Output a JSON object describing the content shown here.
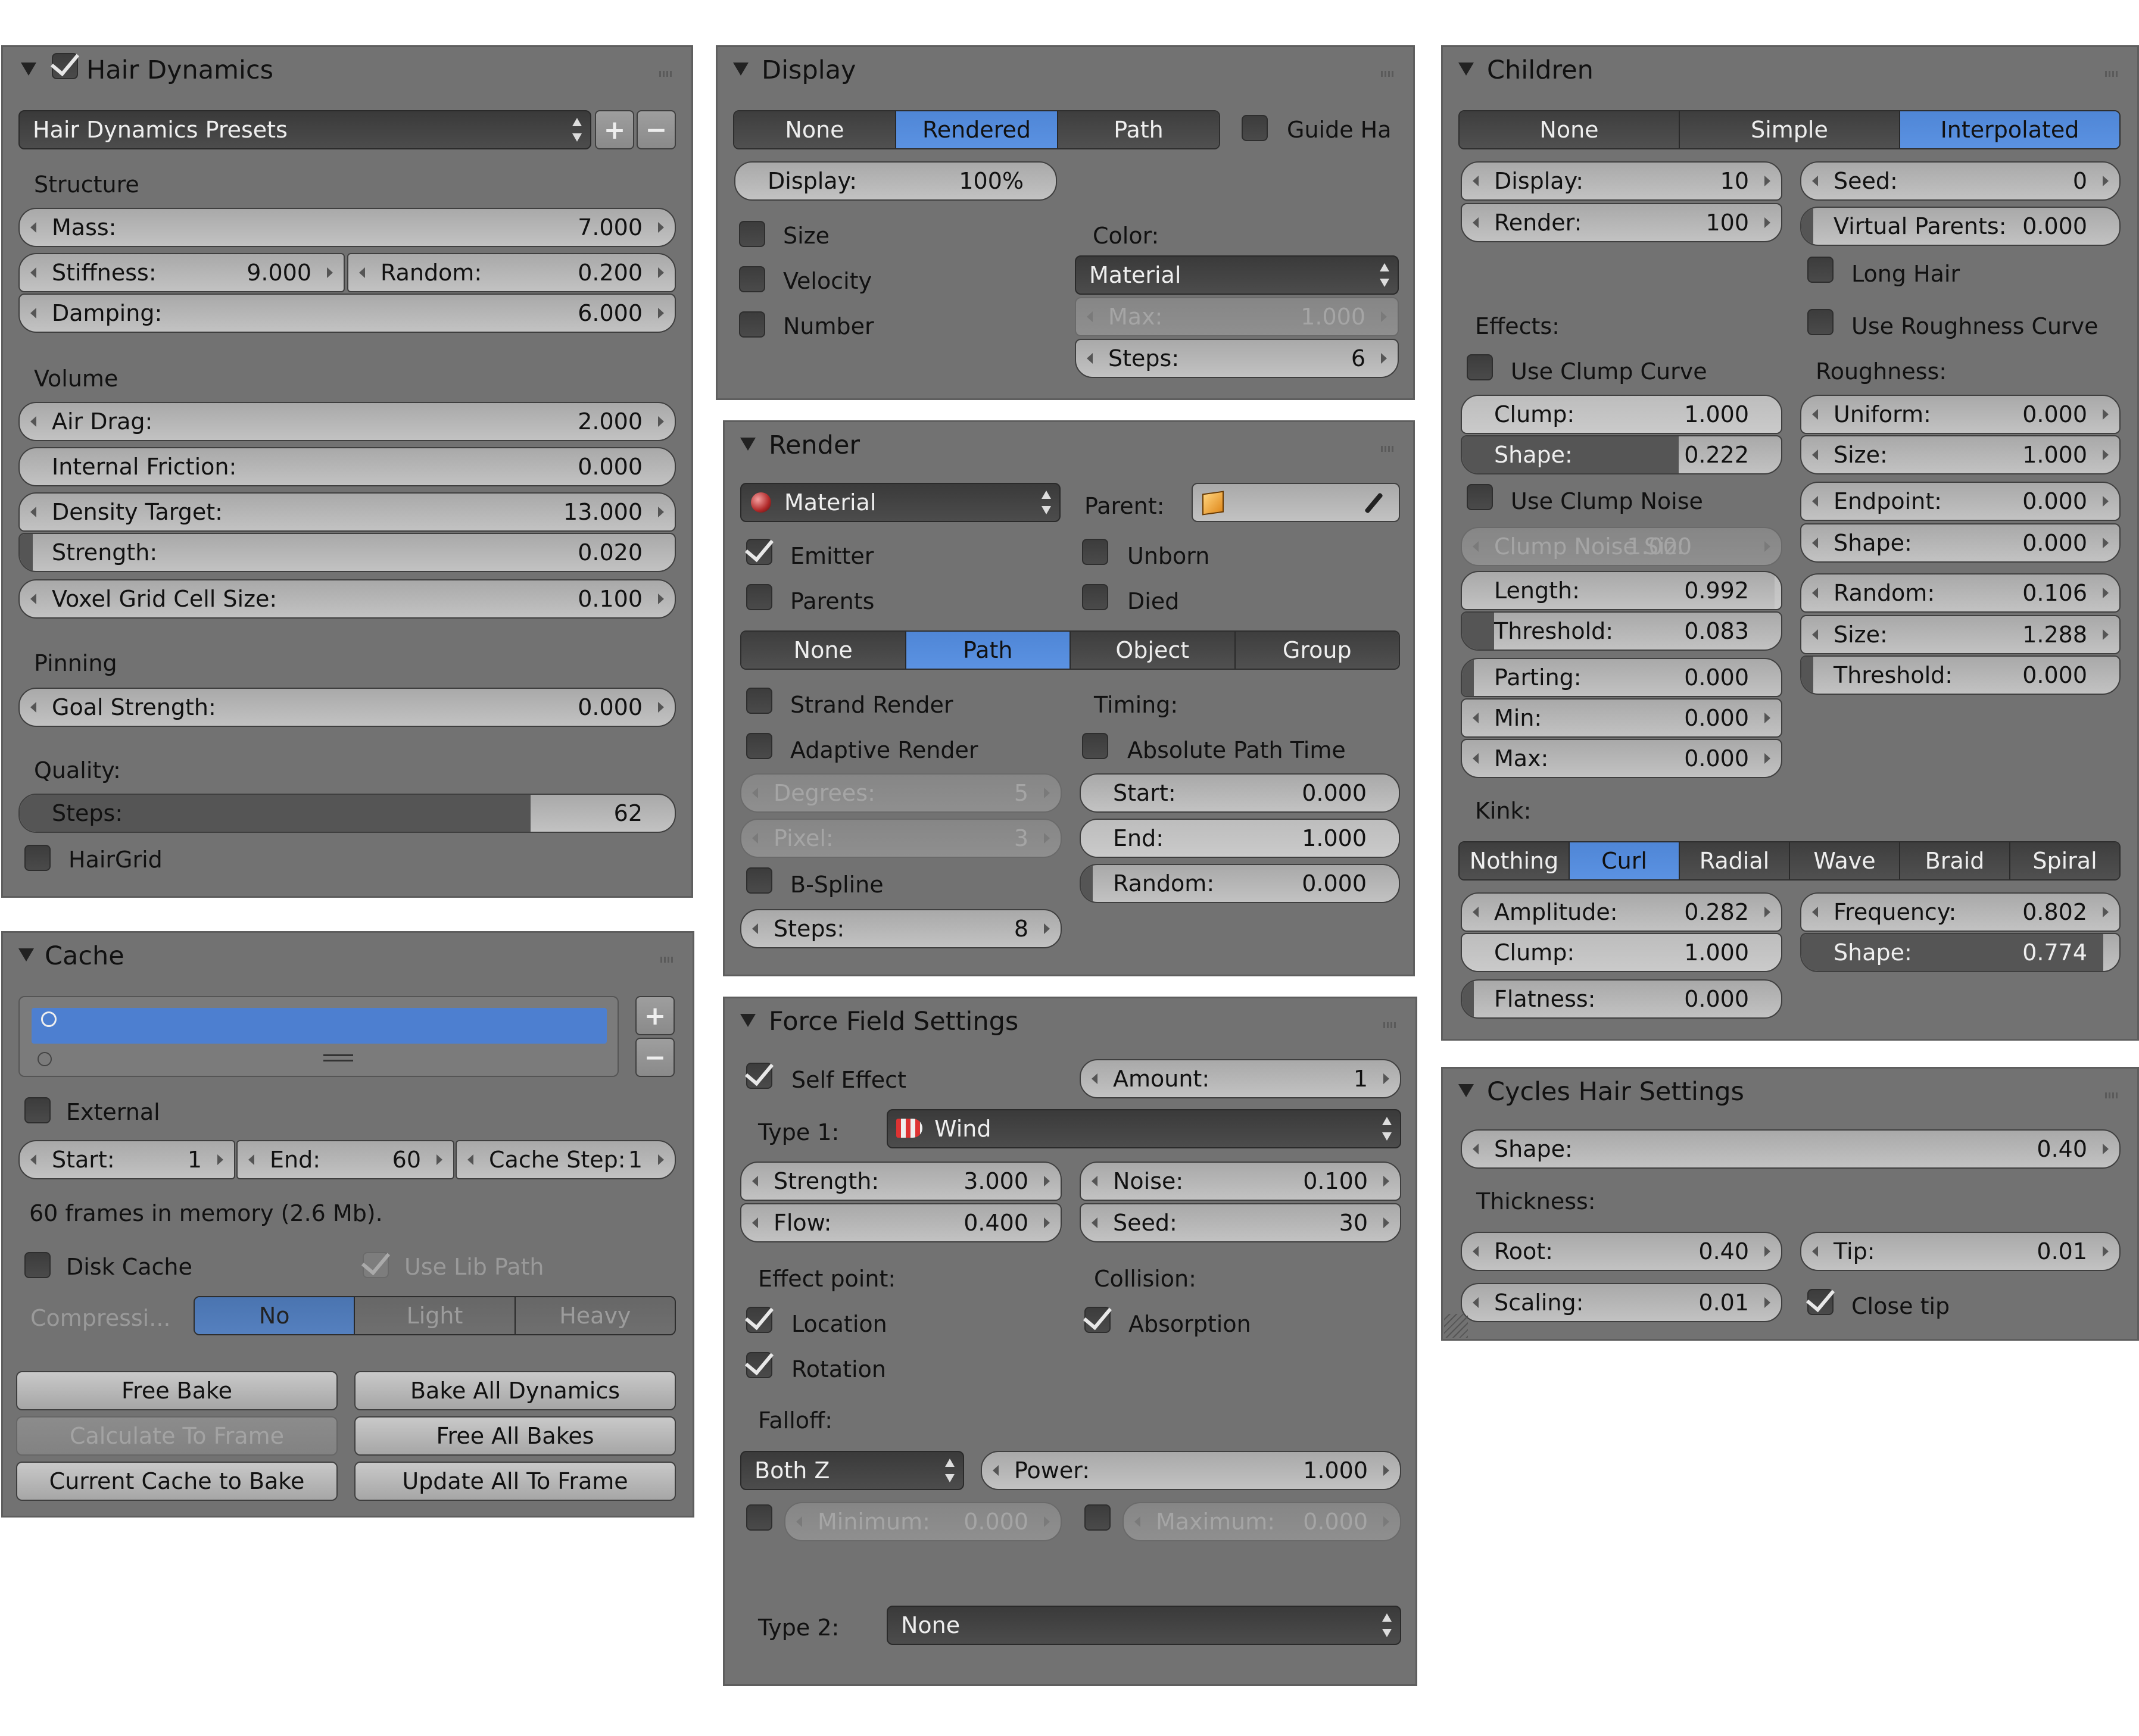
{
  "hair_dynamics": {
    "title": "Hair Dynamics",
    "presets": "Hair Dynamics Presets",
    "add": "+",
    "remove": "−",
    "structure": "Structure",
    "mass_l": "Mass:",
    "mass_v": "7.000",
    "stiff_l": "Stiffness:",
    "stiff_v": "9.000",
    "rand_l": "Random:",
    "rand_v": "0.200",
    "damp_l": "Damping:",
    "damp_v": "6.000",
    "volume": "Volume",
    "air_l": "Air Drag:",
    "air_v": "2.000",
    "fric_l": "Internal Friction:",
    "fric_v": "0.000",
    "dens_l": "Density Target:",
    "dens_v": "13.000",
    "str_l": "Strength:",
    "str_v": "0.020",
    "voxel_l": "Voxel Grid Cell Size:",
    "voxel_v": "0.100",
    "pinning": "Pinning",
    "goal_l": "Goal Strength:",
    "goal_v": "0.000",
    "quality": "Quality:",
    "steps_l": "Steps:",
    "steps_v": "62",
    "steps_fill": 0.78,
    "hairgrid": "HairGrid"
  },
  "cache": {
    "title": "Cache",
    "external": "External",
    "start_l": "Start:",
    "start_v": "1",
    "end_l": "End:",
    "end_v": "60",
    "step_l": "Cache Step:",
    "step_v": "1",
    "info": "60 frames in memory (2.6 Mb).",
    "disk": "Disk Cache",
    "lib": "Use Lib Path",
    "compress": "Compressi...",
    "comp_opts": [
      "No",
      "Light",
      "Heavy"
    ],
    "free_bake": "Free Bake",
    "bake_all": "Bake All Dynamics",
    "calc": "Calculate To Frame",
    "free_all": "Free All Bakes",
    "current": "Current Cache to Bake",
    "update": "Update All To Frame"
  },
  "display": {
    "title": "Display",
    "opts": [
      "None",
      "Rendered",
      "Path"
    ],
    "guide": "Guide Ha",
    "disp_l": "Display:",
    "disp_v": "100%",
    "size": "Size",
    "velocity": "Velocity",
    "number": "Number",
    "color": "Color:",
    "color_v": "Material",
    "max_l": "Max:",
    "max_v": "1.000",
    "steps_l": "Steps:",
    "steps_v": "6"
  },
  "render": {
    "title": "Render",
    "material": "Material",
    "parent": "Parent:",
    "emitter": "Emitter",
    "unborn": "Unborn",
    "parents": "Parents",
    "died": "Died",
    "opts": [
      "None",
      "Path",
      "Object",
      "Group"
    ],
    "strand": "Strand Render",
    "timing": "Timing:",
    "adaptive": "Adaptive Render",
    "abs": "Absolute Path Time",
    "deg_l": "Degrees:",
    "deg_v": "5",
    "start_l": "Start:",
    "start_v": "0.000",
    "pix_l": "Pixel:",
    "pix_v": "3",
    "end_l": "End:",
    "end_v": "1.000",
    "bspline": "B-Spline",
    "rand_l": "Random:",
    "rand_v": "0.000",
    "steps_l": "Steps:",
    "steps_v": "8"
  },
  "force": {
    "title": "Force Field Settings",
    "self": "Self Effect",
    "amount_l": "Amount:",
    "amount_v": "1",
    "type1": "Type 1:",
    "type1_v": "Wind",
    "str_l": "Strength:",
    "str_v": "3.000",
    "noise_l": "Noise:",
    "noise_v": "0.100",
    "flow_l": "Flow:",
    "flow_v": "0.400",
    "seed_l": "Seed:",
    "seed_v": "30",
    "effect": "Effect point:",
    "collision": "Collision:",
    "location": "Location",
    "absorption": "Absorption",
    "rotation": "Rotation",
    "falloff": "Falloff:",
    "falloff_v": "Both Z",
    "power_l": "Power:",
    "power_v": "1.000",
    "min_l": "Minimum:",
    "min_v": "0.000",
    "max_l": "Maximum:",
    "max_v": "0.000",
    "type2": "Type 2:",
    "type2_v": "None"
  },
  "children": {
    "title": "Children",
    "opts": [
      "None",
      "Simple",
      "Interpolated"
    ],
    "disp_l": "Display:",
    "disp_v": "10",
    "seed_l": "Seed:",
    "seed_v": "0",
    "rend_l": "Render:",
    "rend_v": "100",
    "vp_l": "Virtual Parents:",
    "vp_v": "0.000",
    "long": "Long Hair",
    "effects": "Effects:",
    "rough_curve": "Use Roughness Curve",
    "clump_curve": "Use Clump Curve",
    "roughness": "Roughness:",
    "clump_l": "Clump:",
    "clump_v": "1.000",
    "uni_l": "Uniform:",
    "uni_v": "0.000",
    "shape_l": "Shape:",
    "shape_v": "0.222",
    "size_l": "Size:",
    "size_v": "1.000",
    "clump_noise": "Use Clump Noise",
    "end_l": "Endpoint:",
    "end_v": "0.000",
    "cns_l": "Clump Noise Siz:",
    "cns_v": "1.000",
    "eshape_l": "Shape:",
    "eshape_v": "0.000",
    "len_l": "Length:",
    "len_v": "0.992",
    "rnd_l": "Random:",
    "rnd_v": "0.106",
    "thr_l": "Threshold:",
    "thr_v": "0.083",
    "rsize_l": "Size:",
    "rsize_v": "1.288",
    "part_l": "Parting:",
    "part_v": "0.000",
    "rthr_l": "Threshold:",
    "rthr_v": "0.000",
    "min_l": "Min:",
    "min_v": "0.000",
    "max_l": "Max:",
    "max_v": "0.000",
    "kink": "Kink:",
    "kinks": [
      "Nothing",
      "Curl",
      "Radial",
      "Wave",
      "Braid",
      "Spiral"
    ],
    "amp_l": "Amplitude:",
    "amp_v": "0.282",
    "freq_l": "Frequency:",
    "freq_v": "0.802",
    "kclump_l": "Clump:",
    "kclump_v": "1.000",
    "kshape_l": "Shape:",
    "kshape_v": "0.774",
    "flat_l": "Flatness:",
    "flat_v": "0.000"
  },
  "cycles": {
    "title": "Cycles Hair Settings",
    "shape_l": "Shape:",
    "shape_v": "0.40",
    "thickness": "Thickness:",
    "root_l": "Root:",
    "root_v": "0.40",
    "tip_l": "Tip:",
    "tip_v": "0.01",
    "scal_l": "Scaling:",
    "scal_v": "0.01",
    "close": "Close tip"
  }
}
